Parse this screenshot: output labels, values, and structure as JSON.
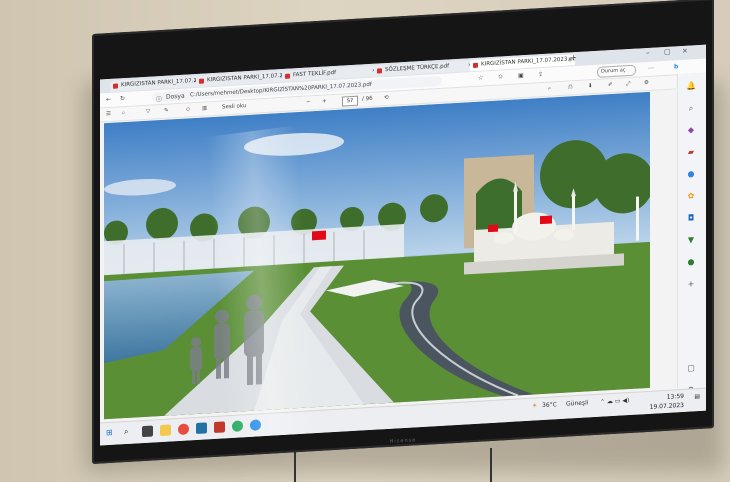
{
  "tabs": [
    {
      "title": "KIRGIZISTAN PARKI_17.07.2"
    },
    {
      "title": "KIRGIZISTAN PARKI_17.07.2"
    },
    {
      "title": "FAST TEKLİF.pdf"
    },
    {
      "title": "SÖZLEŞME TÜRKÇE.pdf"
    },
    {
      "title": "KIRGIZİSTAN PARKI_17.07.2023.pdf"
    }
  ],
  "address": {
    "file_label": "Dosya",
    "url": "C:/Users/mehmet/Desktop/KIRGIZİSTAN%20PARKI_17.07.2023.pdf"
  },
  "profile": {
    "label": "Durum aç"
  },
  "pdf_toolbar": {
    "page_current": "57",
    "page_total": "/ 96",
    "read_aloud": "Sesli oku",
    "zoom_minus": "−",
    "zoom_plus": "+"
  },
  "taskbar": {
    "weather": "36°C",
    "weather_desc": "Güneşli",
    "time": "13:59",
    "date": "19.07.2023"
  },
  "tv": {
    "brand": "Hisense"
  },
  "colors": {
    "sky": "#4a86c8",
    "grass": "#4f8a2e",
    "water": "#5b93b8",
    "mosque": "#eeeeea",
    "arch": "#c9b79a",
    "flag": "#e30a17",
    "pdf_icon": "#d32f2f"
  },
  "icons": [
    "back-icon",
    "refresh-icon",
    "info-icon",
    "star-icon",
    "favorites-icon",
    "collections-icon",
    "share-icon",
    "menu-icon",
    "search-icon",
    "bing-icon",
    "draw-icon",
    "highlight-icon",
    "erase-icon",
    "print-icon",
    "save-icon",
    "fullscreen-icon",
    "settings-icon",
    "windows-start-icon",
    "chrome-icon",
    "edge-icon",
    "file-explorer-icon",
    "settings-gear-icon"
  ]
}
